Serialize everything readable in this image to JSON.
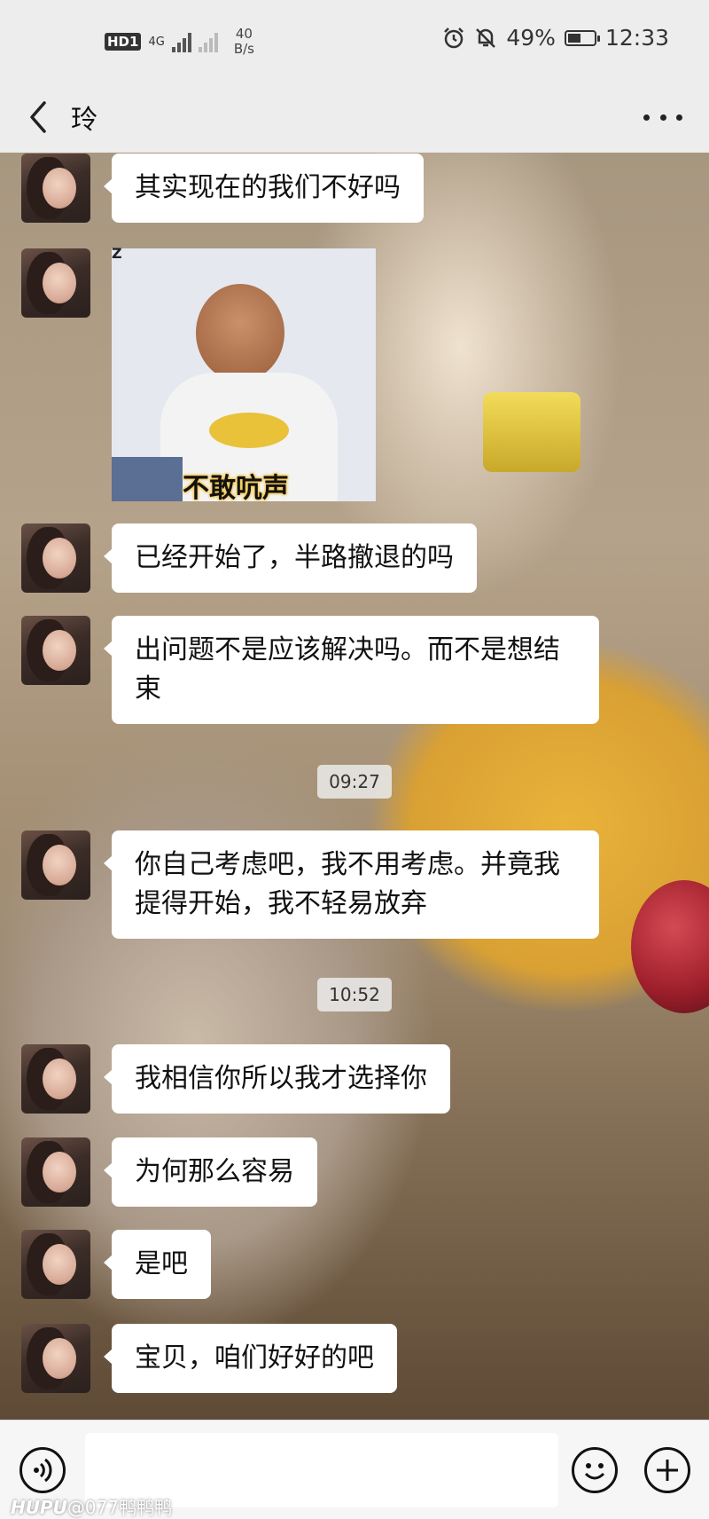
{
  "status_bar": {
    "hd": "HD",
    "hd_sub": "1",
    "network": "4G",
    "speed_value": "40",
    "speed_unit": "B/s",
    "battery": "49%",
    "battery_level": 0.49,
    "time": "12:33"
  },
  "header": {
    "title": "玲"
  },
  "messages": [
    {
      "type": "text",
      "text": "其实现在的我们不好吗"
    },
    {
      "type": "sticker",
      "tag": "Z",
      "caption": "不敢吭声"
    },
    {
      "type": "text",
      "text": "已经开始了，半路撤退的吗"
    },
    {
      "type": "text",
      "text": "出问题不是应该解决吗。而不是想结束"
    },
    {
      "type": "time",
      "text": "09:27"
    },
    {
      "type": "text",
      "text": "你自己考虑吧，我不用考虑。并竟我提得开始，我不轻易放弃"
    },
    {
      "type": "time",
      "text": "10:52"
    },
    {
      "type": "text",
      "text": "我相信你所以我才选择你"
    },
    {
      "type": "text",
      "text": "为何那么容易"
    },
    {
      "type": "text",
      "text": "是吧"
    },
    {
      "type": "text",
      "text": "宝贝，咱们好好的吧"
    }
  ],
  "input": {
    "value": ""
  },
  "watermark": {
    "brand": "HUPU",
    "user": "@077鸭鸭鸭"
  }
}
